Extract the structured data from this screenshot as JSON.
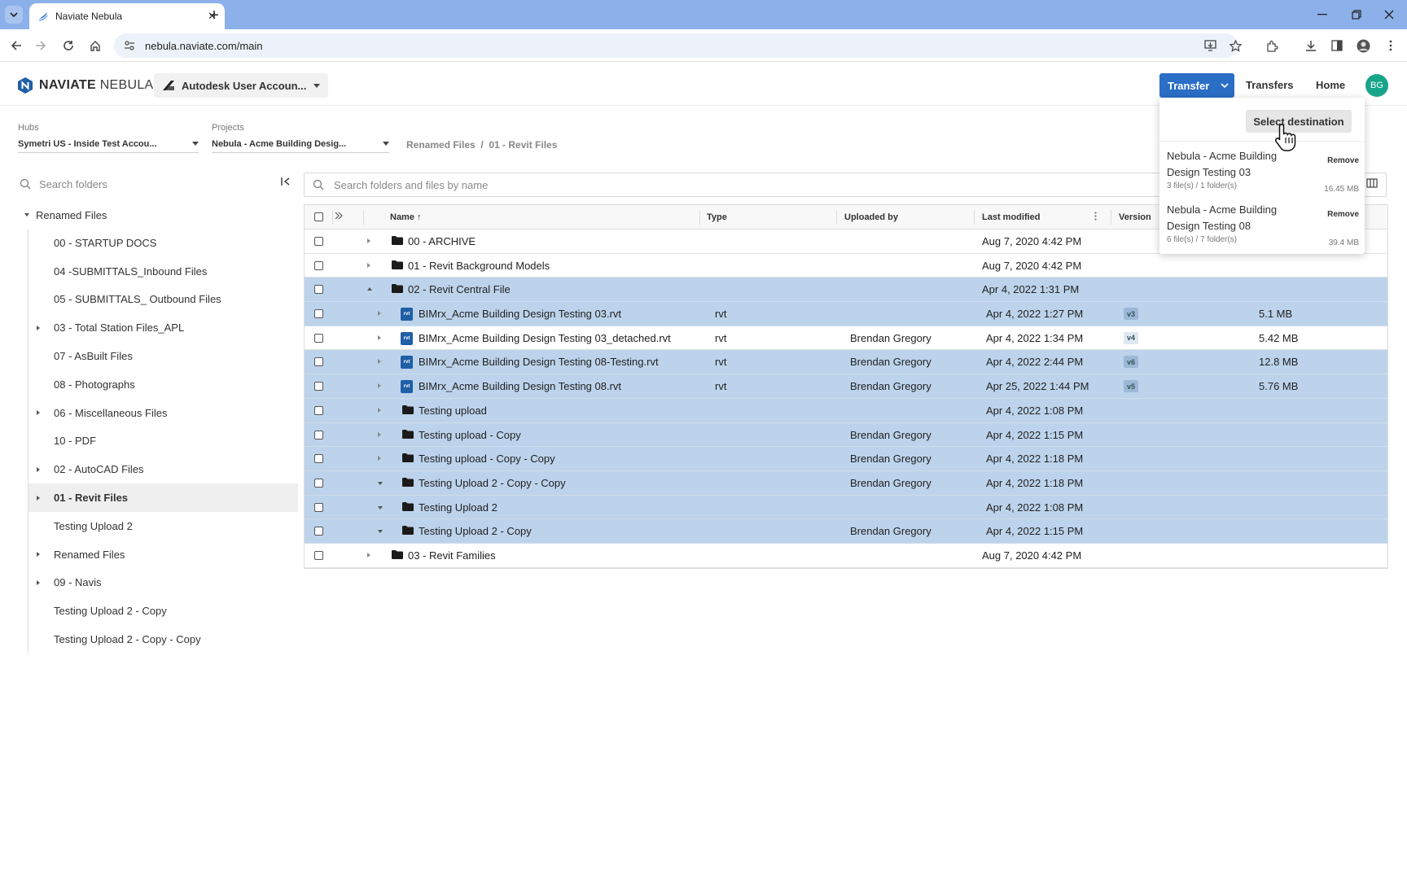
{
  "browser": {
    "tab_title": "Naviate Nebula",
    "url": "nebula.naviate.com/main"
  },
  "header": {
    "logo_bold": "NAVIATE",
    "logo_light": "NEBULA",
    "account_label": "Autodesk User Accoun...",
    "transfer_label": "Transfer",
    "transfers_link": "Transfers",
    "home_link": "Home",
    "avatar_initials": "BG",
    "accent_color": "#2a6ec6"
  },
  "filters": {
    "hubs_label": "Hubs",
    "hubs_value": "Symetri US - Inside Test Accou...",
    "projects_label": "Projects",
    "projects_value": "Nebula - Acme Building Desig...",
    "breadcrumb": "Renamed Files  /  01 - Revit Files"
  },
  "sidebar": {
    "search_placeholder": "Search folders",
    "root": "Renamed Files",
    "items": [
      {
        "label": "00 - STARTUP DOCS",
        "expandable": false
      },
      {
        "label": "04 -SUBMITTALS_Inbound Files",
        "expandable": false
      },
      {
        "label": "05 - SUBMITTALS_ Outbound Files",
        "expandable": false
      },
      {
        "label": "03 - Total Station Files_APL",
        "expandable": true
      },
      {
        "label": "07 - AsBuilt Files",
        "expandable": false
      },
      {
        "label": "08 - Photographs",
        "expandable": false
      },
      {
        "label": "06 - Miscellaneous Files",
        "expandable": true
      },
      {
        "label": "10 - PDF",
        "expandable": false
      },
      {
        "label": "02 - AutoCAD Files",
        "expandable": true
      },
      {
        "label": "01 - Revit Files",
        "expandable": true,
        "active": true
      },
      {
        "label": "Testing Upload 2",
        "expandable": false
      },
      {
        "label": "Renamed Files",
        "expandable": true
      },
      {
        "label": "09 - Navis",
        "expandable": true
      },
      {
        "label": "Testing Upload 2 - Copy",
        "expandable": false
      },
      {
        "label": "Testing Upload 2 - Copy - Copy",
        "expandable": false
      }
    ]
  },
  "main": {
    "search_placeholder": "Search folders and files by name",
    "columns": {
      "name": "Name",
      "type": "Type",
      "uploaded_by": "Uploaded by",
      "last_modified": "Last modified",
      "version": "Version"
    },
    "rows": [
      {
        "kind": "folder",
        "level": 0,
        "toggle": "right",
        "selected": false,
        "name": "00 - ARCHIVE",
        "type": "",
        "uploaded_by": "",
        "modified": "Aug 7, 2020 4:42 PM",
        "version": "",
        "size": ""
      },
      {
        "kind": "folder",
        "level": 0,
        "toggle": "right",
        "selected": false,
        "name": "01 - Revit Background Models",
        "type": "",
        "uploaded_by": "",
        "modified": "Aug 7, 2020 4:42 PM",
        "version": "",
        "size": ""
      },
      {
        "kind": "folder",
        "level": 0,
        "toggle": "up",
        "selected": true,
        "name": "02 - Revit Central File",
        "type": "",
        "uploaded_by": "",
        "modified": "Apr 4, 2022 1:31 PM",
        "version": "",
        "size": ""
      },
      {
        "kind": "rvt",
        "level": 1,
        "toggle": "right",
        "selected": true,
        "name": "BIMrx_Acme Building Design Testing 03.rvt",
        "type": "rvt",
        "uploaded_by": "",
        "modified": "Apr 4, 2022 1:27 PM",
        "version": "v3",
        "size": "5.1 MB"
      },
      {
        "kind": "rvt",
        "level": 1,
        "toggle": "right",
        "selected": false,
        "name": "BIMrx_Acme Building Design Testing 03_detached.rvt",
        "type": "rvt",
        "uploaded_by": "Brendan Gregory",
        "modified": "Apr 4, 2022 1:34 PM",
        "version": "v4",
        "size": "5.42 MB"
      },
      {
        "kind": "rvt",
        "level": 1,
        "toggle": "right",
        "selected": true,
        "name": "BIMrx_Acme Building Design Testing 08-Testing.rvt",
        "type": "rvt",
        "uploaded_by": "Brendan Gregory",
        "modified": "Apr 4, 2022 2:44 PM",
        "version": "v6",
        "size": "12.8 MB"
      },
      {
        "kind": "rvt",
        "level": 1,
        "toggle": "right",
        "selected": true,
        "name": "BIMrx_Acme Building Design Testing 08.rvt",
        "type": "rvt",
        "uploaded_by": "Brendan Gregory",
        "modified": "Apr 25, 2022 1:44 PM",
        "version": "v5",
        "size": "5.76 MB"
      },
      {
        "kind": "folder",
        "level": 1,
        "toggle": "right",
        "selected": true,
        "name": "Testing upload",
        "type": "",
        "uploaded_by": "",
        "modified": "Apr 4, 2022 1:08 PM",
        "version": "",
        "size": ""
      },
      {
        "kind": "folder",
        "level": 1,
        "toggle": "right",
        "selected": true,
        "name": "Testing upload - Copy",
        "type": "",
        "uploaded_by": "Brendan Gregory",
        "modified": "Apr 4, 2022 1:15 PM",
        "version": "",
        "size": ""
      },
      {
        "kind": "folder",
        "level": 1,
        "toggle": "right",
        "selected": true,
        "name": "Testing upload - Copy - Copy",
        "type": "",
        "uploaded_by": "Brendan Gregory",
        "modified": "Apr 4, 2022 1:18 PM",
        "version": "",
        "size": ""
      },
      {
        "kind": "folder",
        "level": 1,
        "toggle": "down",
        "selected": true,
        "name": "Testing Upload 2 - Copy - Copy",
        "type": "",
        "uploaded_by": "Brendan Gregory",
        "modified": "Apr 4, 2022 1:18 PM",
        "version": "",
        "size": ""
      },
      {
        "kind": "folder",
        "level": 1,
        "toggle": "down",
        "selected": true,
        "name": "Testing Upload 2",
        "type": "",
        "uploaded_by": "",
        "modified": "Apr 4, 2022 1:08 PM",
        "version": "",
        "size": ""
      },
      {
        "kind": "folder",
        "level": 1,
        "toggle": "down",
        "selected": true,
        "name": "Testing Upload 2 - Copy",
        "type": "",
        "uploaded_by": "Brendan Gregory",
        "modified": "Apr 4, 2022 1:15 PM",
        "version": "",
        "size": ""
      },
      {
        "kind": "folder",
        "level": 0,
        "toggle": "right",
        "selected": false,
        "name": "03 - Revit Families",
        "type": "",
        "uploaded_by": "",
        "modified": "Aug 7, 2020 4:42 PM",
        "version": "",
        "size": ""
      }
    ]
  },
  "transfer_dropdown": {
    "select_destination": "Select destination",
    "remove_label": "Remove",
    "items": [
      {
        "name": "Nebula - Acme Building Design Testing 03",
        "counts": "3 file(s) / 1 folder(s)",
        "size": "16.45 MB"
      },
      {
        "name": "Nebula - Acme Building Design Testing 08",
        "counts": "6 file(s) / 7 folder(s)",
        "size": "39.4 MB"
      }
    ]
  }
}
